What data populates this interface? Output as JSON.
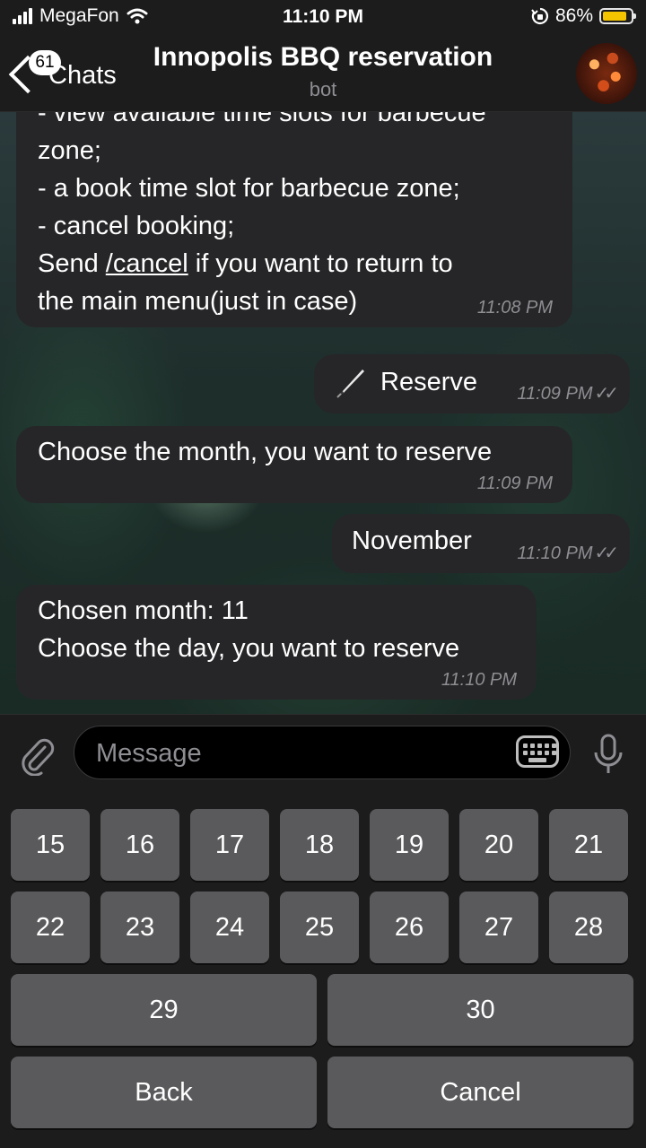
{
  "status": {
    "carrier": "MegaFon",
    "time": "11:10 PM",
    "battery": "86%",
    "battery_level": 0.86
  },
  "header": {
    "back_badge": "61",
    "back_label": "Chats",
    "title": "Innopolis BBQ reservation",
    "subtitle": "bot"
  },
  "messages": [
    {
      "direction": "in",
      "lines": [
        "- view available time slots for barbecue",
        "zone;",
        "- a book time slot for barbecue zone;",
        "- cancel booking;"
      ],
      "line5_before": "Send ",
      "line5_link": "/cancel",
      "line5_after": " if you want to return to",
      "line6": "the main menu(just in case)",
      "time": "11:08 PM"
    },
    {
      "direction": "out",
      "text": "Reserve",
      "time": "11:09 PM"
    },
    {
      "direction": "in",
      "text": "Choose the month, you want to reserve",
      "time": "11:09 PM"
    },
    {
      "direction": "out",
      "text": "November",
      "time": "11:10 PM"
    },
    {
      "direction": "in",
      "lines": [
        "Chosen month: 11",
        "Choose the day, you want to reserve"
      ],
      "time": "11:10 PM"
    }
  ],
  "input": {
    "placeholder": "Message"
  },
  "keyboard": {
    "row1": [
      "15",
      "16",
      "17",
      "18",
      "19",
      "20",
      "21"
    ],
    "row2": [
      "22",
      "23",
      "24",
      "25",
      "26",
      "27",
      "28"
    ],
    "row3": [
      "29",
      "30"
    ],
    "row4": [
      "Back",
      "Cancel"
    ]
  },
  "colors": {
    "bubble": "#262628",
    "key": "#5a5a5c",
    "background": "#1c1c1d",
    "battery": "#f5c400"
  }
}
